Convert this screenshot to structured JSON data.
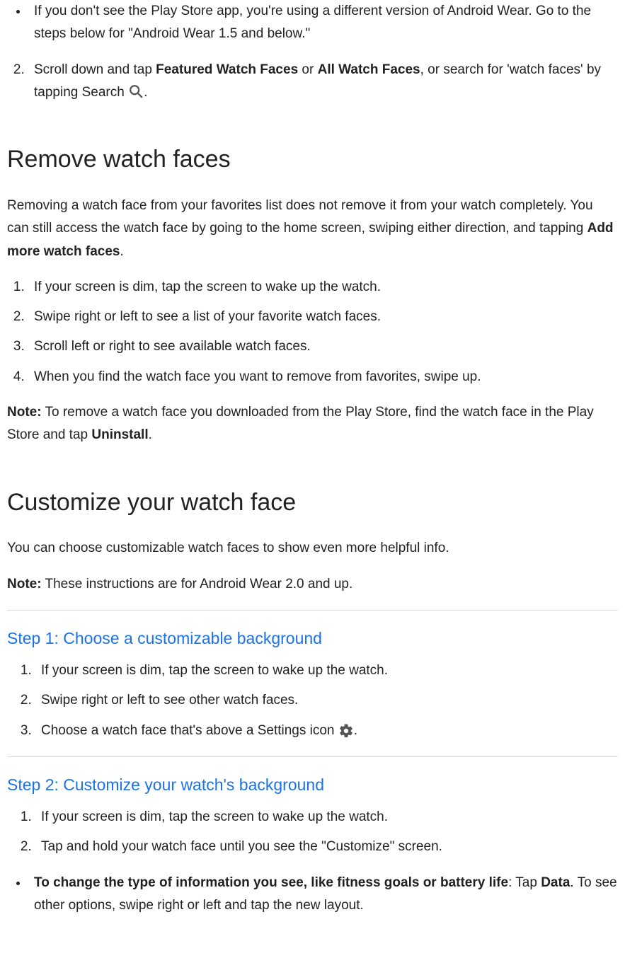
{
  "top_list": {
    "bullet1": "If you don't see the Play Store app, you're using a different version of Android Wear. Go to the steps below for \"Android Wear 1.5 and below.\"",
    "step2_part1": "Scroll down and tap ",
    "step2_bold1": "Featured Watch Faces",
    "step2_mid": " or ",
    "step2_bold2": "All Watch Faces",
    "step2_part2": ", or search for 'watch faces' by tapping Search ",
    "step2_end": "."
  },
  "remove": {
    "heading": "Remove watch faces",
    "intro_p1": "Removing a watch face from your favorites list does not remove it from your watch completely. You can still access the watch face by going to the home screen, swiping either direction, and tapping ",
    "intro_bold": "Add more watch faces",
    "intro_p2": ".",
    "steps": {
      "s1": "If your screen is dim, tap the screen to wake up the watch.",
      "s2": "Swipe right or left to see a list of your favorite watch faces.",
      "s3": "Scroll left or right to see available watch faces.",
      "s4": "When you find the watch face you want to remove from favorites, swipe up."
    },
    "note_label": "Note:",
    "note_text": " To remove a watch face you downloaded from the Play Store, find the watch face in the Play Store and tap ",
    "note_bold": "Uninstall",
    "note_end": "."
  },
  "customize": {
    "heading": "Customize your watch face",
    "intro": "You can choose customizable watch faces to show even more helpful info.",
    "note_label": "Note:",
    "note_text": " These instructions are for Android Wear 2.0 and up.",
    "step1": {
      "title": "Step 1: Choose a customizable background",
      "s1": "If your screen is dim, tap the screen to wake up the watch.",
      "s2": "Swipe right or left to see other watch faces.",
      "s3a": "Choose a watch face that's above a Settings icon",
      "s3b": "."
    },
    "step2": {
      "title": "Step 2: Customize your watch's background",
      "s1": "If your screen is dim, tap the screen to wake up the watch.",
      "s2": "Tap and hold your watch face until you see the \"Customize\" screen.",
      "bullet_bold": "To change the type of information you see, like fitness goals or battery life",
      "bullet_p1": ": Tap ",
      "bullet_bold2": "Data",
      "bullet_p2": ". To see other options, swipe right or left and tap the new layout."
    }
  }
}
